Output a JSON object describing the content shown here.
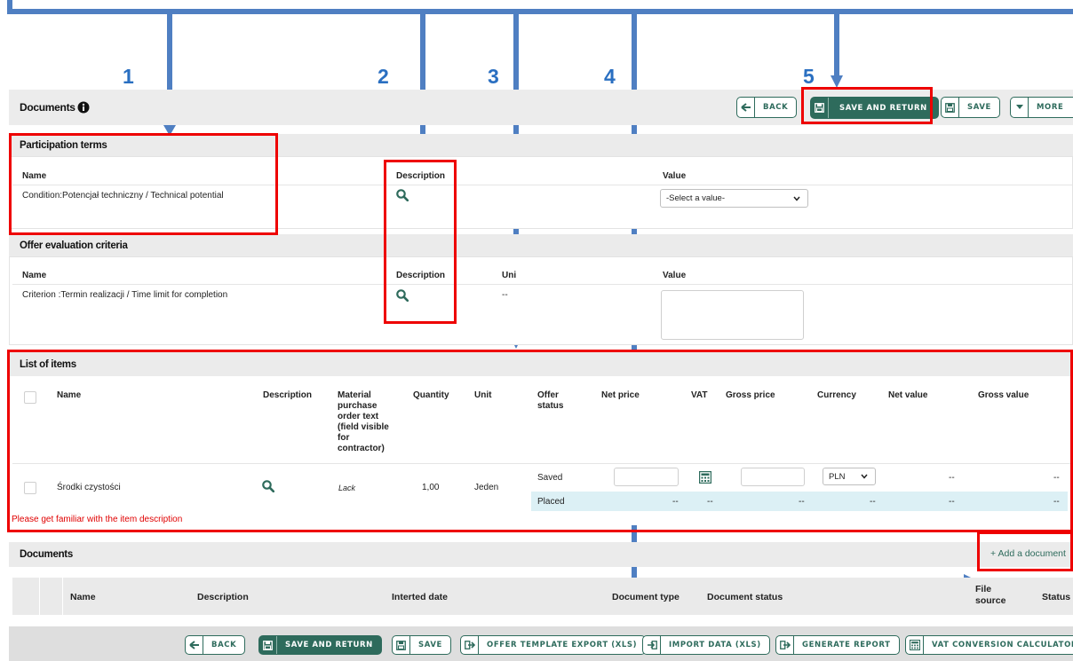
{
  "callouts": [
    "1",
    "2",
    "3",
    "4",
    "5"
  ],
  "header": {
    "title": "Documents",
    "info_icon": "info-circle-icon",
    "back_label": "BACK",
    "save_return_label": "SAVE AND RETURN",
    "save_label": "SAVE",
    "more_label": "MORE"
  },
  "participation": {
    "title": "Participation terms",
    "col_name": "Name",
    "col_description": "Description",
    "col_value": "Value",
    "row_name": "Condition:Potencjał techniczny / Technical potential",
    "select_value": "-Select a value-"
  },
  "criteria": {
    "title": "Offer evaluation criteria",
    "col_name": "Name",
    "col_description": "Description",
    "col_unit": "Uni",
    "col_value": "Value",
    "row_name": "Criterion :Termin realizacji / Time limit for completion",
    "row_unit": "--"
  },
  "items": {
    "title": "List of items",
    "columns": {
      "name": "Name",
      "description": "Description",
      "material_l1": "Material",
      "material_l2": "purchase",
      "material_l3": "order text",
      "material_l4": "(field visible",
      "material_l5": "for",
      "material_l6": "contractor)",
      "quantity": "Quantity",
      "unit": "Unit",
      "offer_status_l1": "Offer",
      "offer_status_l2": "status",
      "net_price": "Net price",
      "vat": "VAT",
      "gross_price": "Gross price",
      "currency": "Currency",
      "net_value": "Net value",
      "gross_value": "Gross value"
    },
    "row": {
      "name": "Środki czystości",
      "material_text": "Lack",
      "quantity": "1,00",
      "unit": "Jeden",
      "status_saved": "Saved",
      "status_placed": "Placed",
      "currency": "PLN",
      "net_value": "--",
      "gross_value": "--",
      "placed_net_price": "--",
      "placed_vat": "--",
      "placed_gross_price": "--",
      "placed_currency": "--",
      "placed_net_value": "--",
      "placed_gross_value": "--"
    },
    "warning": "Please get familiar with the item description"
  },
  "documents": {
    "title": "Documents",
    "add_label": "+ Add a document",
    "columns": {
      "name": "Name",
      "description": "Description",
      "inserted_date": "Interted date",
      "document_type": "Document type",
      "document_status": "Document status",
      "file_source_l1": "File",
      "file_source_l2": "source",
      "status": "Status"
    }
  },
  "footer": {
    "back": "BACK",
    "save_return": "SAVE AND RETURN",
    "save": "SAVE",
    "template_export": "OFFER TEMPLATE EXPORT (XLS)",
    "import_data": "IMPORT DATA (XLS)",
    "generate_report": "GENERATE REPORT",
    "vat_calc": "VAT CONVERSION CALCULATOR"
  },
  "colors": {
    "accent": "#2e6b5c",
    "highlight_red": "#ee0000",
    "annotation_blue": "#4f7fc2",
    "callout_blue": "#2a6fc1",
    "warning_text": "#e00000",
    "placed_row_bg": "#dcf0f5"
  }
}
